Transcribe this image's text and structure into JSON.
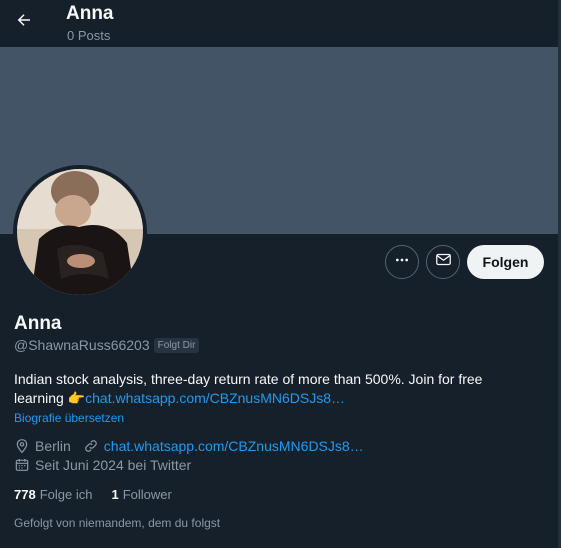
{
  "header": {
    "title": "Anna",
    "posts": "0 Posts"
  },
  "actions": {
    "follow_label": "Folgen"
  },
  "profile": {
    "name": "Anna",
    "handle": "@ShawnaRuss66203",
    "follows_you": "Folgt Dir",
    "bio_text": "Indian stock  analysis, three-day  return rate of more than 500%. Join for  free learning ",
    "bio_emoji": "👉",
    "bio_link": "chat.whatsapp.com/CBZnusMN6DSJs8…",
    "translate_label": "Biografie übersetzen",
    "location": "Berlin",
    "website": "chat.whatsapp.com/CBZnusMN6DSJs8…",
    "joined": "Seit Juni 2024 bei Twitter"
  },
  "stats": {
    "following_count": "778",
    "following_label": "Folge ich",
    "followers_count": "1",
    "followers_label": "Follower"
  },
  "followed_by": "Gefolgt von niemandem, dem du folgst",
  "colors": {
    "background": "#15202b",
    "banner": "#425466",
    "link": "#1d9bf0",
    "secondary_text": "#8b98a5"
  }
}
